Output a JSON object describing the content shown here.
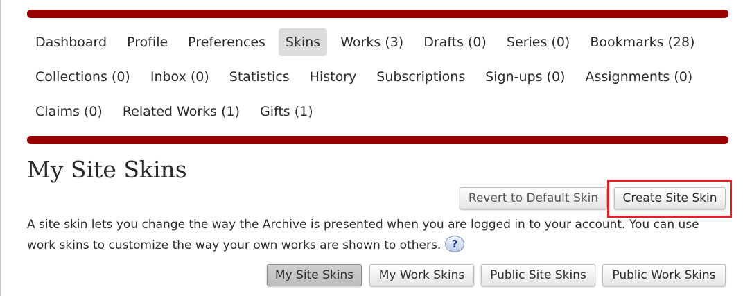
{
  "nav": {
    "rows": [
      [
        "Dashboard",
        "Profile",
        "Preferences",
        "Skins",
        "Works (3)",
        "Drafts (0)",
        "Series (0)",
        "Bookmarks (28)"
      ],
      [
        "Collections (0)",
        "Inbox (0)",
        "Statistics",
        "History",
        "Subscriptions",
        "Sign-ups (0)",
        "Assignments (0)"
      ],
      [
        "Claims (0)",
        "Related Works (1)",
        "Gifts (1)"
      ]
    ],
    "active": "Skins",
    "accent_color": "#990000"
  },
  "page": {
    "title": "My Site Skins",
    "actions": {
      "revert_label": "Revert to Default Skin",
      "create_label": "Create Site Skin"
    },
    "description": "A site skin lets you change the way the Archive is presented when you are logged in to your account. You can use work skins to customize the way your own works are shown to others.",
    "help_icon": "?",
    "highlight_color": "#e0202a"
  },
  "skin_tabs": {
    "items": [
      "My Site Skins",
      "My Work Skins",
      "Public Site Skins",
      "Public Work Skins"
    ],
    "active": "My Site Skins"
  }
}
